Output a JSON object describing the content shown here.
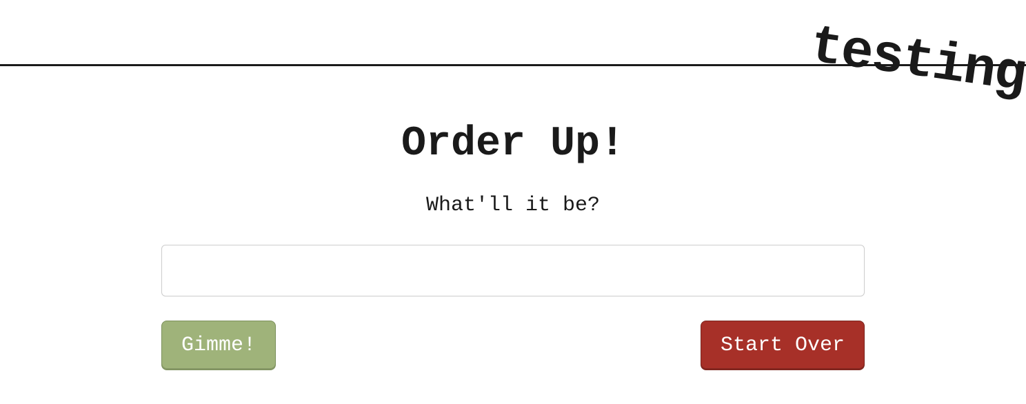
{
  "ribbon": {
    "text": "testing"
  },
  "main": {
    "title": "Order Up!",
    "subtitle": "What'll it be?",
    "input_value": "",
    "input_placeholder": ""
  },
  "buttons": {
    "gimme_label": "Gimme!",
    "start_over_label": "Start Over"
  },
  "colors": {
    "primary_button": "#9fb37a",
    "danger_button": "#a73028",
    "text": "#1a1a1a"
  }
}
